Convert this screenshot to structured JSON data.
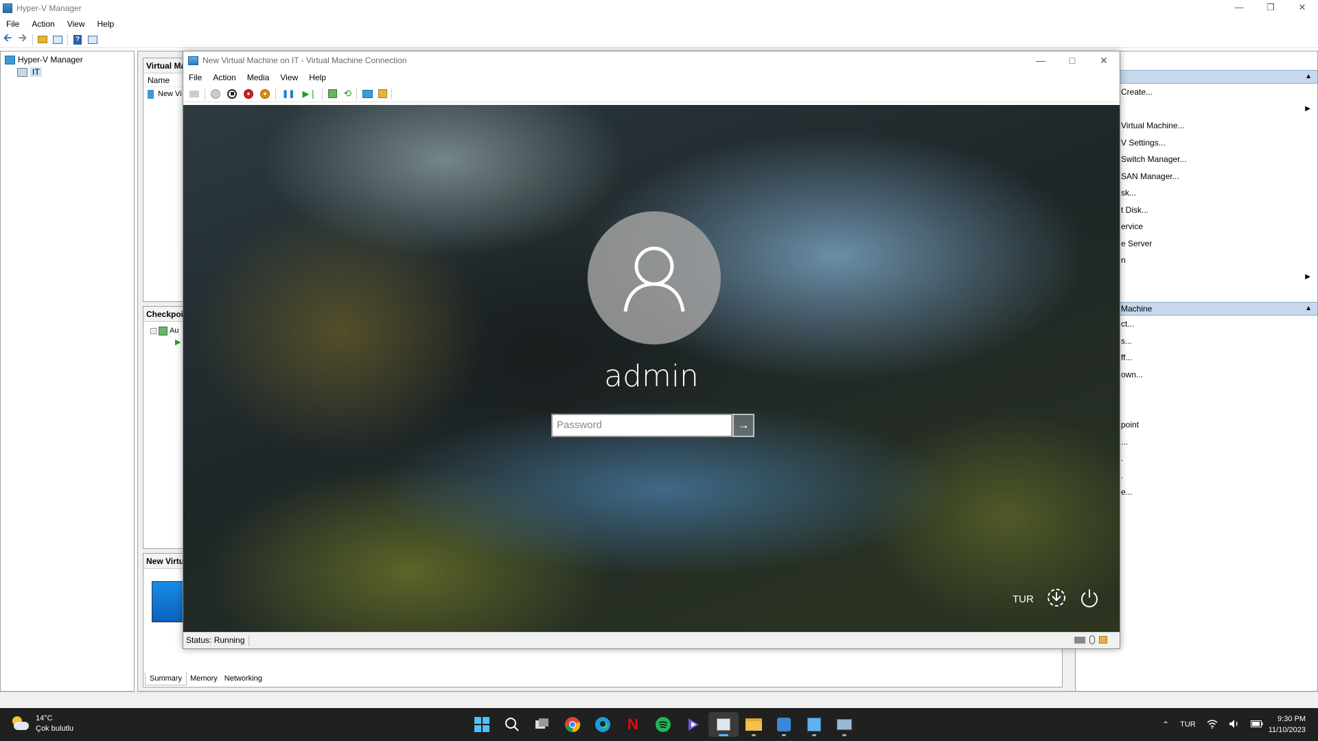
{
  "hv": {
    "title": "Hyper-V Manager",
    "menu": [
      "File",
      "Action",
      "View",
      "Help"
    ],
    "tree": {
      "root": "Hyper-V Manager",
      "host": "IT"
    },
    "vm_panel_header": "Virtual Ma",
    "name_col": "Name",
    "vm_row": "New Vi",
    "checkpoints_header": "Checkpoi",
    "checkpoint_item": "Au",
    "details_header": "New Virtu",
    "detail_tabs": [
      "Summary",
      "Memory",
      "Networking"
    ],
    "actions": {
      "section1": [
        {
          "label": "Create..."
        },
        {
          "label": "",
          "has_submenu": true
        },
        {
          "label": "Virtual Machine..."
        },
        {
          "label": "V Settings..."
        },
        {
          "label": "Switch Manager..."
        },
        {
          "label": "SAN Manager..."
        },
        {
          "label": "sk..."
        },
        {
          "label": "t Disk..."
        },
        {
          "label": "ervice"
        },
        {
          "label": "e Server"
        },
        {
          "label": "n"
        },
        {
          "label": "",
          "has_submenu": true
        }
      ],
      "section2_header": "Machine",
      "section2": [
        {
          "label": "ct..."
        },
        {
          "label": "s..."
        },
        {
          "label": "ff..."
        },
        {
          "label": "own..."
        },
        {
          "label": ""
        },
        {
          "label": ""
        },
        {
          "label": "point"
        },
        {
          "label": "..."
        },
        {
          "label": "."
        },
        {
          "label": "."
        },
        {
          "label": "e..."
        }
      ]
    }
  },
  "vm": {
    "title": "New Virtual Machine on IT - Virtual Machine Connection",
    "menu": [
      "File",
      "Action",
      "Media",
      "View",
      "Help"
    ],
    "username": "admin",
    "password_placeholder": "Password",
    "language": "TUR",
    "status": "Status: Running"
  },
  "taskbar": {
    "weather_temp": "14°C",
    "weather_desc": "Çok bulutlu",
    "lang": "TUR",
    "time": "9:30 PM",
    "date": "11/10/2023"
  },
  "colors": {
    "taskbar_bg": "#202020",
    "actions_header_bg": "#c7d8ec",
    "start_blue": "#4cc2ff"
  }
}
